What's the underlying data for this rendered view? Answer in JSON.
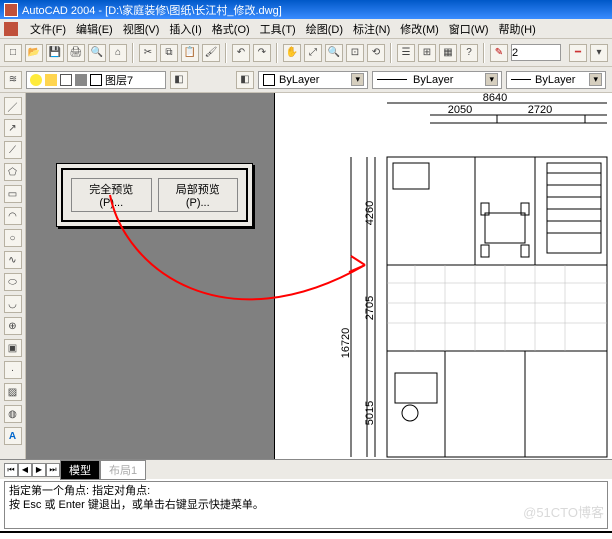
{
  "title": "AutoCAD 2004 - [D:\\家庭装修\\图纸\\长江村_修改.dwg]",
  "menu": {
    "file": "文件(F)",
    "edit": "编辑(E)",
    "view": "视图(V)",
    "insert": "插入(I)",
    "format": "格式(O)",
    "tools": "工具(T)",
    "draw": "绘图(D)",
    "dim": "标注(N)",
    "modify": "修改(M)",
    "window": "窗口(W)",
    "help": "帮助(H)"
  },
  "lineweight_value": "2",
  "layer": {
    "name": "图层7"
  },
  "props": {
    "color": "ByLayer",
    "ltype": "ByLayer",
    "lweight": "ByLayer"
  },
  "dialog": {
    "btn1": "完全预览(P)...",
    "btn2": "局部预览(P)..."
  },
  "tabs": {
    "model": "模型",
    "layout": "布局1"
  },
  "cmd": {
    "l1": "指定第一个角点: 指定对角点:",
    "l2": "按 Esc 或 Enter 键退出，或单击右键显示快捷菜单。"
  },
  "dims": {
    "top_total": "8640",
    "top_a": "2050",
    "top_b": "2720",
    "left_a": "4260",
    "left_b": "2705",
    "left_c": "5015",
    "far_left": "16720"
  },
  "watermark": "@51CTO博客"
}
